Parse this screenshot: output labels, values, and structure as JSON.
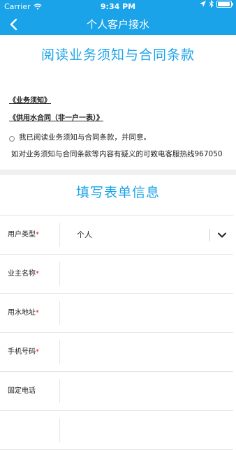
{
  "status_bar": {
    "carrier": "Carrier",
    "time": "9:34 PM"
  },
  "nav": {
    "title": "个人客户接水"
  },
  "terms": {
    "heading": "阅读业务须知与合同条款",
    "links": [
      "《业务须知》",
      "《供用水合同（非一户一表）》"
    ],
    "agree_text": "我已阅读业务须知与合同条款，并同意。",
    "hotline_text": "如对业务须知与合同条款等内容有疑义的可致电客服热线967050"
  },
  "form": {
    "heading": "填写表单信息",
    "user_type_label": "用户类型",
    "user_type_value": "个人",
    "owner_name_label": "业主名称",
    "water_address_label": "用水地址",
    "mobile_label": "手机号码",
    "phone_label": "固定电话",
    "required_mark": "*"
  },
  "colors": {
    "brand": "#1aa3e8",
    "required": "#e02020"
  },
  "icons": [
    "wifi-icon",
    "location-icon",
    "bluetooth-icon",
    "battery-icon",
    "back-icon",
    "chevron-down-icon"
  ]
}
